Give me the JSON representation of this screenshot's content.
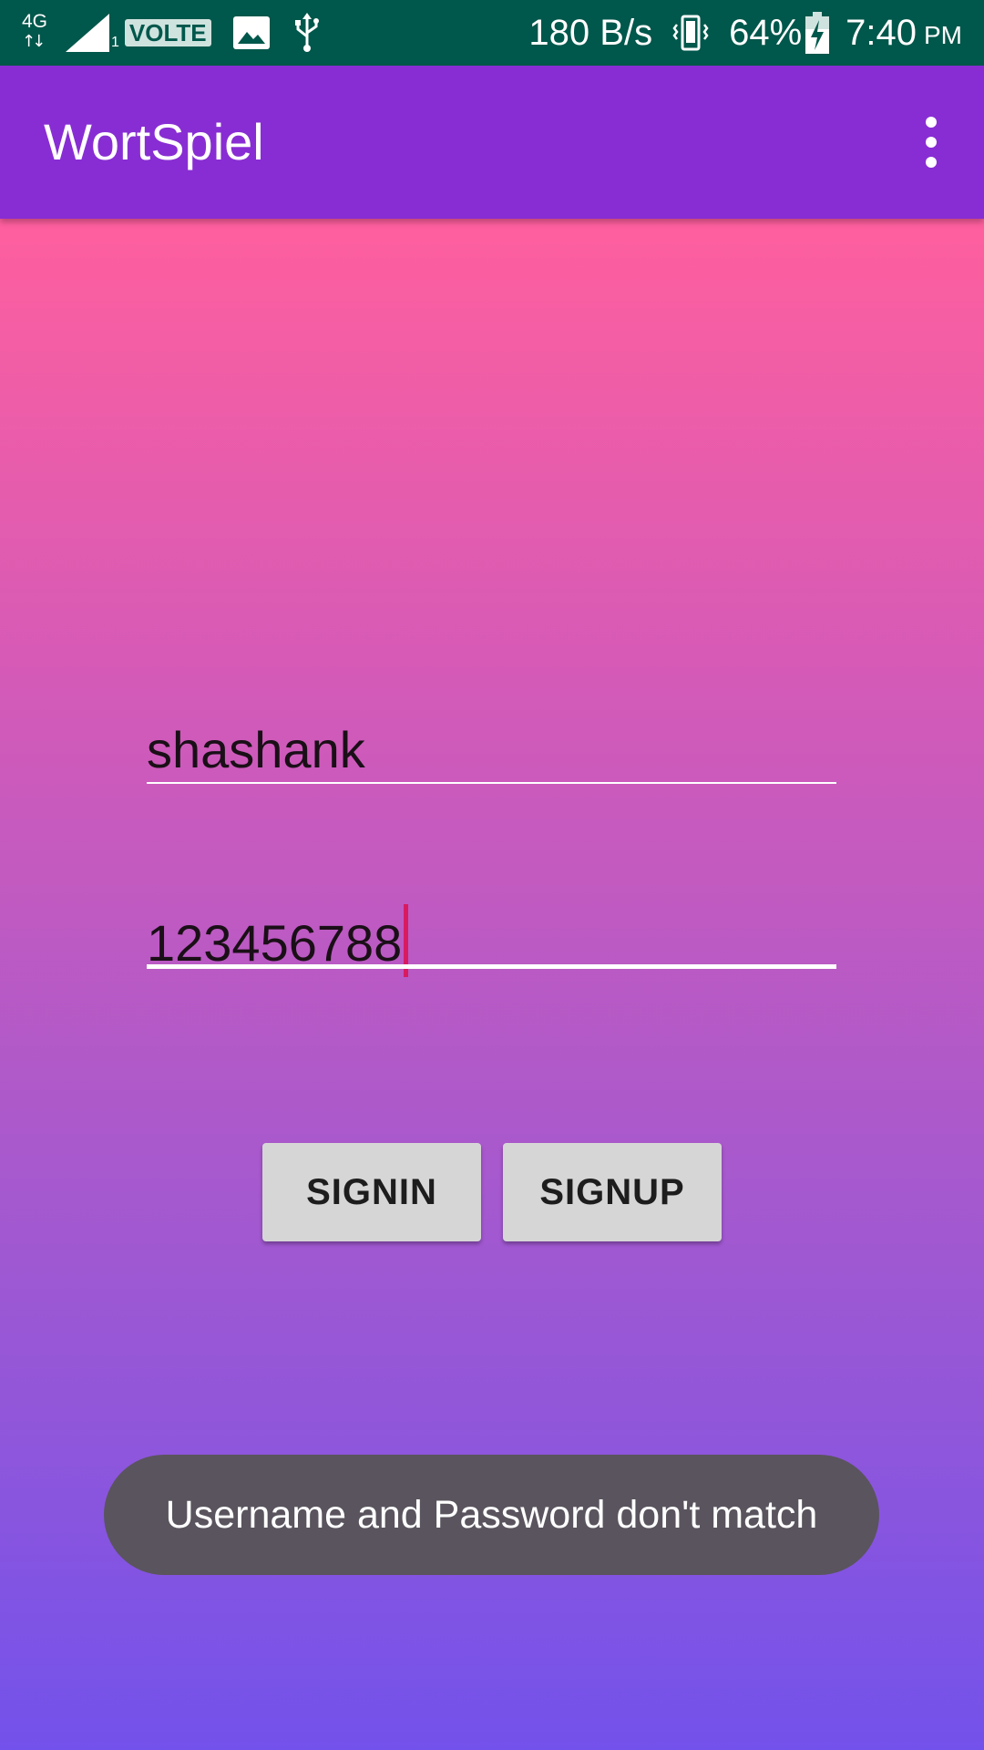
{
  "status_bar": {
    "network_type": "4G",
    "sim_slot": "1",
    "volte": "VOLTE",
    "data_speed": "180 B/s",
    "battery_percent": "64%",
    "battery_level": 0.64,
    "time": "7:40",
    "ampm": "PM",
    "icons": [
      "network-activity-icon",
      "signal-strength-icon",
      "image-notification-icon",
      "usb-icon",
      "vibrate-icon",
      "battery-charging-icon"
    ]
  },
  "app_bar": {
    "title": "WortSpiel",
    "menu_icon": "overflow-menu-icon",
    "color": "#882DD3"
  },
  "form": {
    "username_value": "shashank",
    "password_value": "123456788",
    "focused_field": "password",
    "cursor_color": "#D81B60"
  },
  "buttons": {
    "signin_label": "SIGNIN",
    "signup_label": "SIGNUP"
  },
  "toast": {
    "message": "Username and Password don't match"
  },
  "colors": {
    "status_bar": "#00574B",
    "gradient_top": "#FF5F9E",
    "gradient_bottom": "#7352EB",
    "button_bg": "#D6D6D6",
    "toast_bg": "#5A545E"
  }
}
